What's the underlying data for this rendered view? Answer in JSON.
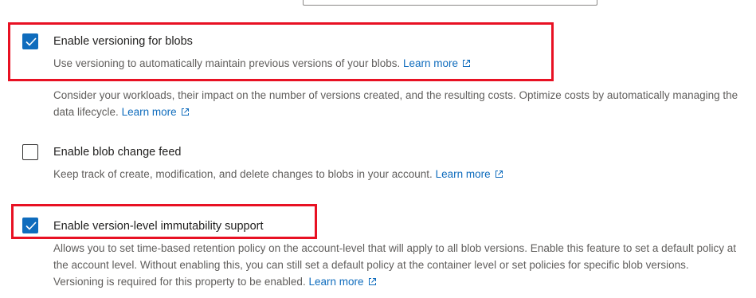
{
  "options": [
    {
      "label": "Enable versioning for blobs",
      "checked": true,
      "description": "Use versioning to automatically maintain previous versions of your blobs.",
      "link": "Learn more",
      "note": "Consider your workloads, their impact on the number of versions created, and the resulting costs. Optimize costs by automatically managing the data lifecycle.",
      "note_link": "Learn more"
    },
    {
      "label": "Enable blob change feed",
      "checked": false,
      "description": "Keep track of create, modification, and delete changes to blobs in your account.",
      "link": "Learn more"
    },
    {
      "label": "Enable version-level immutability support",
      "checked": true,
      "description": "Allows you to set time-based retention policy on the account-level that will apply to all blob versions. Enable this feature to set a default policy at the account level. Without enabling this, you can still set a default policy at the container level or set policies for specific blob versions. Versioning is required for this property to be enabled.",
      "link": "Learn more"
    }
  ],
  "colors": {
    "accent": "#0f6cbd",
    "highlight": "#e81123"
  },
  "icons": {
    "checkmark": "checkmark-icon",
    "external_link": "external-link-icon"
  }
}
